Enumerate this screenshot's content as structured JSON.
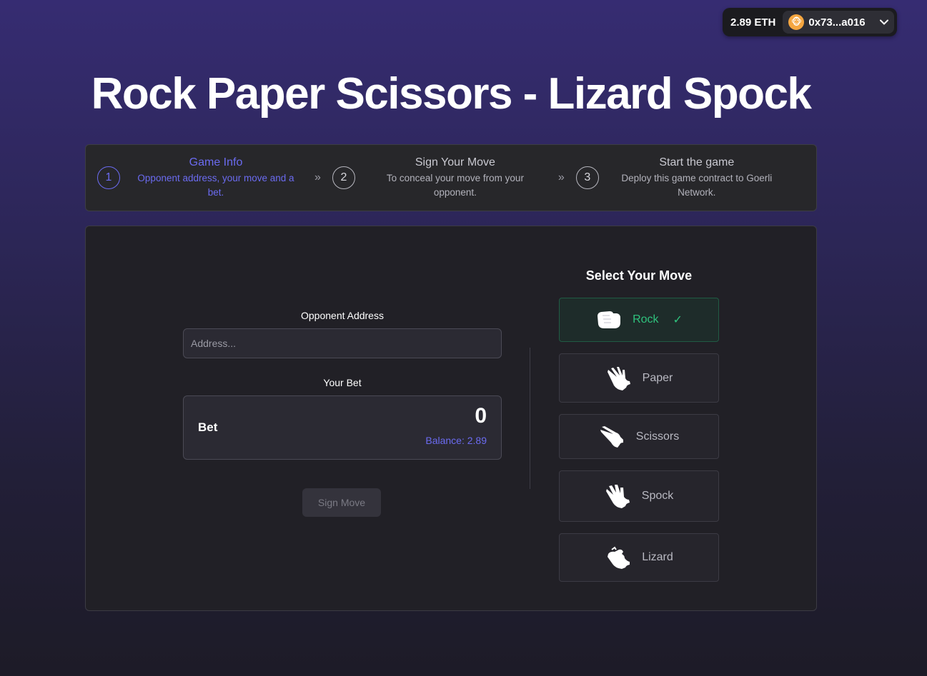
{
  "wallet": {
    "balance": "2.89 ETH",
    "account": "0x73...a016",
    "avatar_icon": "monkey-avatar",
    "chevron": "❯"
  },
  "page": {
    "title": "Rock Paper Scissors - Lizard Spock"
  },
  "stepper": {
    "steps": [
      {
        "number": "1",
        "title": "Game Info",
        "desc_line1": "Opponent address, your move and a",
        "desc_line2": "bet."
      },
      {
        "number": "2",
        "title": "Sign Your Move",
        "desc_line1": "To conceal your move from your",
        "desc_line2": "opponent."
      },
      {
        "number": "3",
        "title": "Start the game",
        "desc_line1": "Deploy this game contract to Goerli",
        "desc_line2": "Network."
      }
    ],
    "separator": "»"
  },
  "form": {
    "opponent_label": "Opponent Address",
    "address_placeholder": "Address...",
    "address_value": "",
    "bet_section_label": "Your Bet",
    "bet_label": "Bet",
    "bet_value": "0",
    "balance": "Balance: 2.89",
    "sign_button": "Sign Move"
  },
  "moves": {
    "title": "Select Your Move",
    "options": [
      {
        "label": "Rock",
        "icon": "rock-hand-icon",
        "selected": true
      },
      {
        "label": "Paper",
        "icon": "paper-hand-icon",
        "selected": false
      },
      {
        "label": "Scissors",
        "icon": "scissors-hand-icon",
        "selected": false
      },
      {
        "label": "Spock",
        "icon": "spock-hand-icon",
        "selected": false
      },
      {
        "label": "Lizard",
        "icon": "lizard-hand-icon",
        "selected": false
      }
    ],
    "check_mark": "✓"
  },
  "colors": {
    "accent": "#6b6bf0",
    "success": "#2fc27d",
    "background_top": "#362c72",
    "background_bottom": "#1d1b27"
  }
}
